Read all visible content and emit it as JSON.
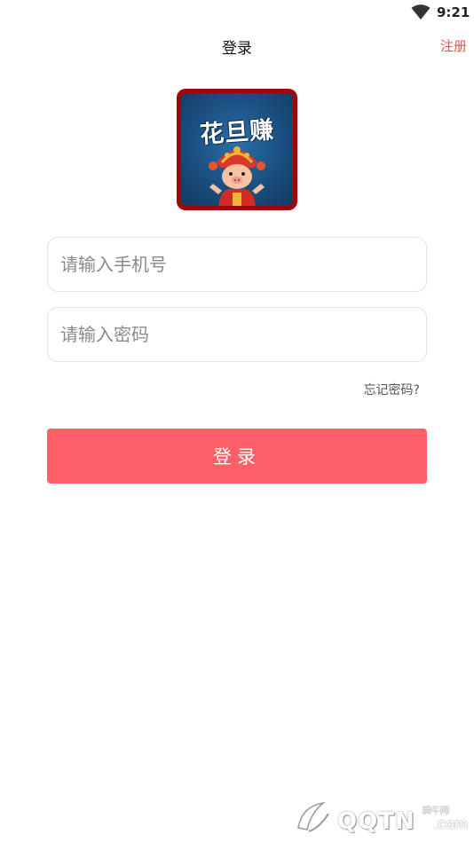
{
  "status_bar": {
    "time": "9:21",
    "wifi_icon": "wifi-icon"
  },
  "header": {
    "title": "登录",
    "register_label": "注册"
  },
  "logo": {
    "text": "花旦赚",
    "mascot_icon": "pig-opera-mascot-icon"
  },
  "form": {
    "phone_placeholder": "请输入手机号",
    "phone_value": "",
    "password_placeholder": "请输入密码",
    "password_value": "",
    "forgot_label": "忘记密码?",
    "login_label": "登录"
  },
  "watermark": {
    "text": "QQTN",
    "small": "腾牛网",
    "suffix": ".com"
  },
  "colors": {
    "accent": "#fd5f66",
    "register": "#f0504b",
    "logo_border": "#a0050a",
    "logo_bg": "#1a4f80"
  }
}
